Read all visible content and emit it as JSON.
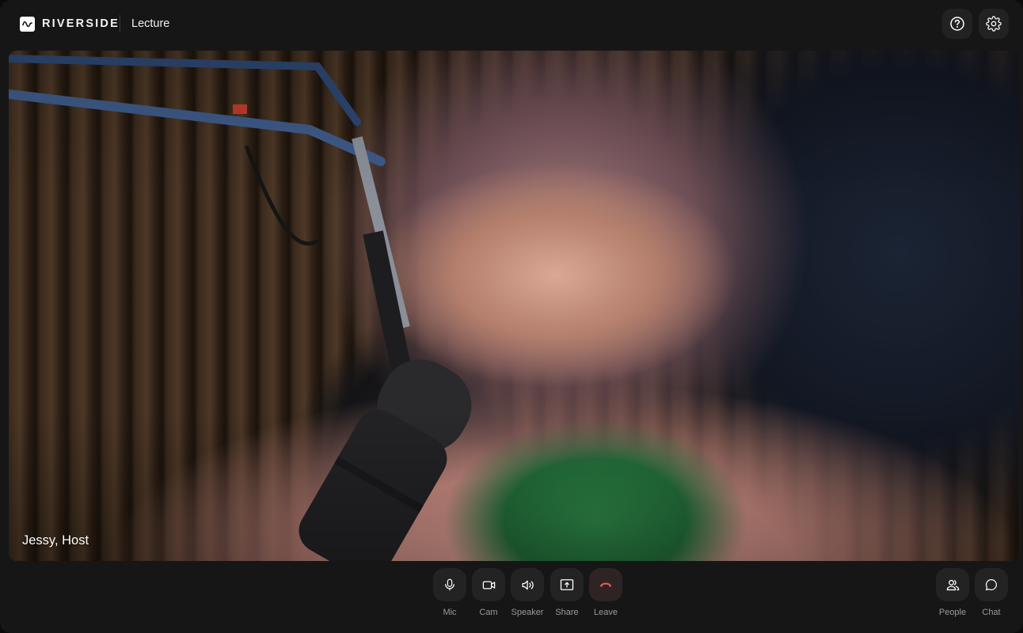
{
  "header": {
    "brand": "RIVERSIDE",
    "session_title": "Lecture",
    "buttons": [
      {
        "name": "help",
        "icon": "question-circle-icon"
      },
      {
        "name": "settings",
        "icon": "gear-icon"
      }
    ]
  },
  "video": {
    "participant_label": "Jessy, Host"
  },
  "controls": {
    "center": [
      {
        "label": "Mic",
        "icon": "microphone-icon"
      },
      {
        "label": "Cam",
        "icon": "camera-icon"
      },
      {
        "label": "Speaker",
        "icon": "speaker-icon"
      },
      {
        "label": "Share",
        "icon": "share-screen-icon"
      },
      {
        "label": "Leave",
        "icon": "hang-up-icon"
      }
    ],
    "right": [
      {
        "label": "People",
        "icon": "people-icon"
      },
      {
        "label": "Chat",
        "icon": "chat-bubble-icon"
      }
    ]
  },
  "colors": {
    "background": "#161616",
    "button_bg": "#232323",
    "leave_accent": "#f0555a",
    "label_gray": "#9a9a9a"
  }
}
